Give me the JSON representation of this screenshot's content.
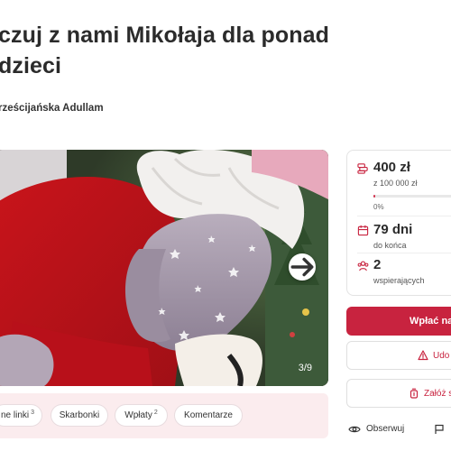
{
  "campaign": {
    "title": "czuj z nami Mikołaja dla ponad\ndzieci",
    "organizer": "rześcijańska Adullam"
  },
  "gallery": {
    "counter": "3/9",
    "next_icon": "arrow-right-icon"
  },
  "tabs": [
    {
      "label": "ne linki",
      "count": "3"
    },
    {
      "label": "Skarbonki",
      "count": ""
    },
    {
      "label": "Wpłaty",
      "count": "2"
    },
    {
      "label": "Komentarze",
      "count": ""
    }
  ],
  "stats": {
    "raised": "400 zł",
    "goal": "z 100 000 zł",
    "progress_label": "0%",
    "progress_fraction": 0.004,
    "days": "79 dni",
    "days_label": "do końca",
    "supporters": "2",
    "supporters_label": "wspierających"
  },
  "actions": {
    "donate": "Wpłać na",
    "share": "Udo",
    "piggybank": "Załóż s"
  },
  "footer": {
    "follow": "Obserwuj"
  },
  "colors": {
    "accent": "#c8233f",
    "tabs_bg": "#fbecee"
  }
}
